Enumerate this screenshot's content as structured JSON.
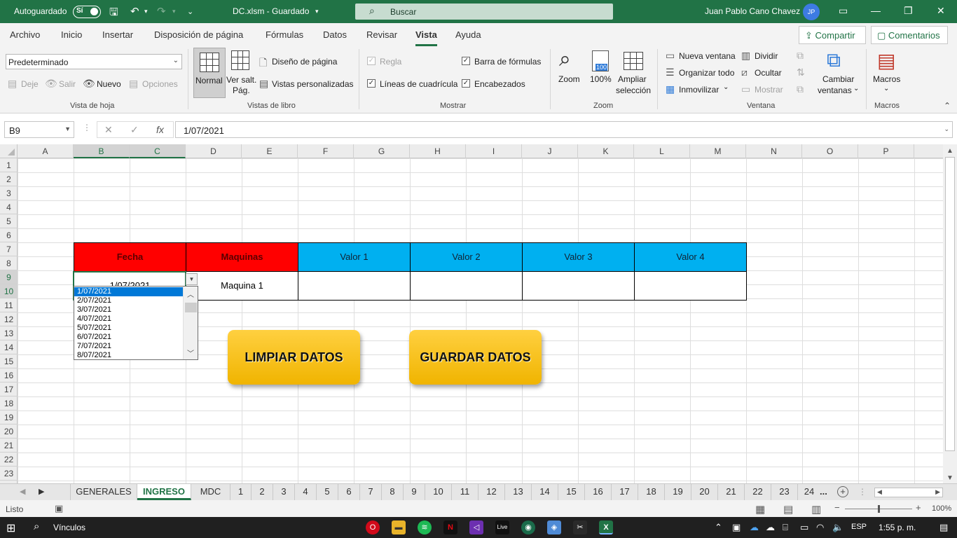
{
  "titlebar": {
    "autosave_label": "Autoguardado",
    "autosave_toggle": "Sí",
    "filename": "DC.xlsm - Guardado",
    "search_placeholder": "Buscar",
    "user_name": "Juan Pablo Cano Chavez",
    "user_initials": "JP",
    "color": "#217346"
  },
  "menu": {
    "tabs": [
      "Archivo",
      "Inicio",
      "Insertar",
      "Disposición de página",
      "Fórmulas",
      "Datos",
      "Revisar",
      "Vista",
      "Ayuda"
    ],
    "active": "Vista",
    "share_label": "Compartir",
    "comments_label": "Comentarios"
  },
  "ribbon": {
    "sheet_view": {
      "select_value": "Predeterminado",
      "keep": "Deje",
      "exit": "Salir",
      "new": "Nuevo",
      "options": "Opciones",
      "group": "Vista de hoja"
    },
    "workbook_views": {
      "normal": "Normal",
      "page_break_1": "Ver salt.",
      "page_break_2": "Pág.",
      "page_layout": "Diseño de página",
      "custom_views": "Vistas personalizadas",
      "group": "Vistas de libro"
    },
    "show": {
      "ruler": "Regla",
      "gridlines": "Líneas de cuadrícula",
      "formula_bar": "Barra de fórmulas",
      "headings": "Encabezados",
      "group": "Mostrar"
    },
    "zoom": {
      "zoom": "Zoom",
      "hundred": "100%",
      "hundred_icon": "100",
      "zoom_sel_1": "Ampliar",
      "zoom_sel_2": "selección",
      "group": "Zoom"
    },
    "window": {
      "new_window": "Nueva ventana",
      "arrange_all": "Organizar todo",
      "freeze": "Inmovilizar",
      "split": "Dividir",
      "hide": "Ocultar",
      "unhide": "Mostrar",
      "switch_1": "Cambiar",
      "switch_2": "ventanas",
      "group": "Ventana"
    },
    "macros": {
      "label": "Macros",
      "group": "Macros"
    }
  },
  "formula_bar": {
    "name_box": "B9",
    "fx": "fx",
    "value": "1/07/2021"
  },
  "sheet": {
    "columns": [
      "A",
      "B",
      "C",
      "D",
      "E",
      "F",
      "G",
      "H",
      "I",
      "J",
      "K",
      "L",
      "M",
      "N",
      "O",
      "P"
    ],
    "rows": [
      "1",
      "2",
      "3",
      "4",
      "5",
      "6",
      "7",
      "8",
      "9",
      "10",
      "11",
      "12",
      "13",
      "14",
      "15",
      "16",
      "17",
      "18",
      "19",
      "20",
      "21",
      "22",
      "23"
    ],
    "table": {
      "headers": [
        "Fecha",
        "Maquinas",
        "Valor 1",
        "Valor 2",
        "Valor 3",
        "Valor 4"
      ],
      "row": [
        "1/07/2021",
        "Maquina 1",
        "",
        "",
        "",
        ""
      ]
    },
    "dropdown_options": [
      "1/07/2021",
      "2/07/2021",
      "3/07/2021",
      "4/07/2021",
      "5/07/2021",
      "6/07/2021",
      "7/07/2021",
      "8/07/2021"
    ],
    "buttons": {
      "clear": "LIMPIAR DATOS",
      "save": "GUARDAR DATOS"
    },
    "colors": {
      "header_red": "#ff0000",
      "header_blue": "#00b0f0",
      "button_yellow": "#f5c000"
    }
  },
  "sheet_tabs": {
    "tabs": [
      "GENERALES",
      "INGRESO",
      "MDC",
      "1",
      "2",
      "3",
      "4",
      "5",
      "6",
      "7",
      "8",
      "9",
      "10",
      "11",
      "12",
      "13",
      "14",
      "15",
      "16",
      "17",
      "18",
      "19",
      "20",
      "21",
      "22",
      "23",
      "24"
    ],
    "active": "INGRESO",
    "more": "..."
  },
  "status": {
    "ready": "Listo",
    "zoom_level": "100%"
  },
  "taskbar": {
    "links": "Vínculos",
    "lang": "ESP",
    "time": "1:55 p. m."
  }
}
